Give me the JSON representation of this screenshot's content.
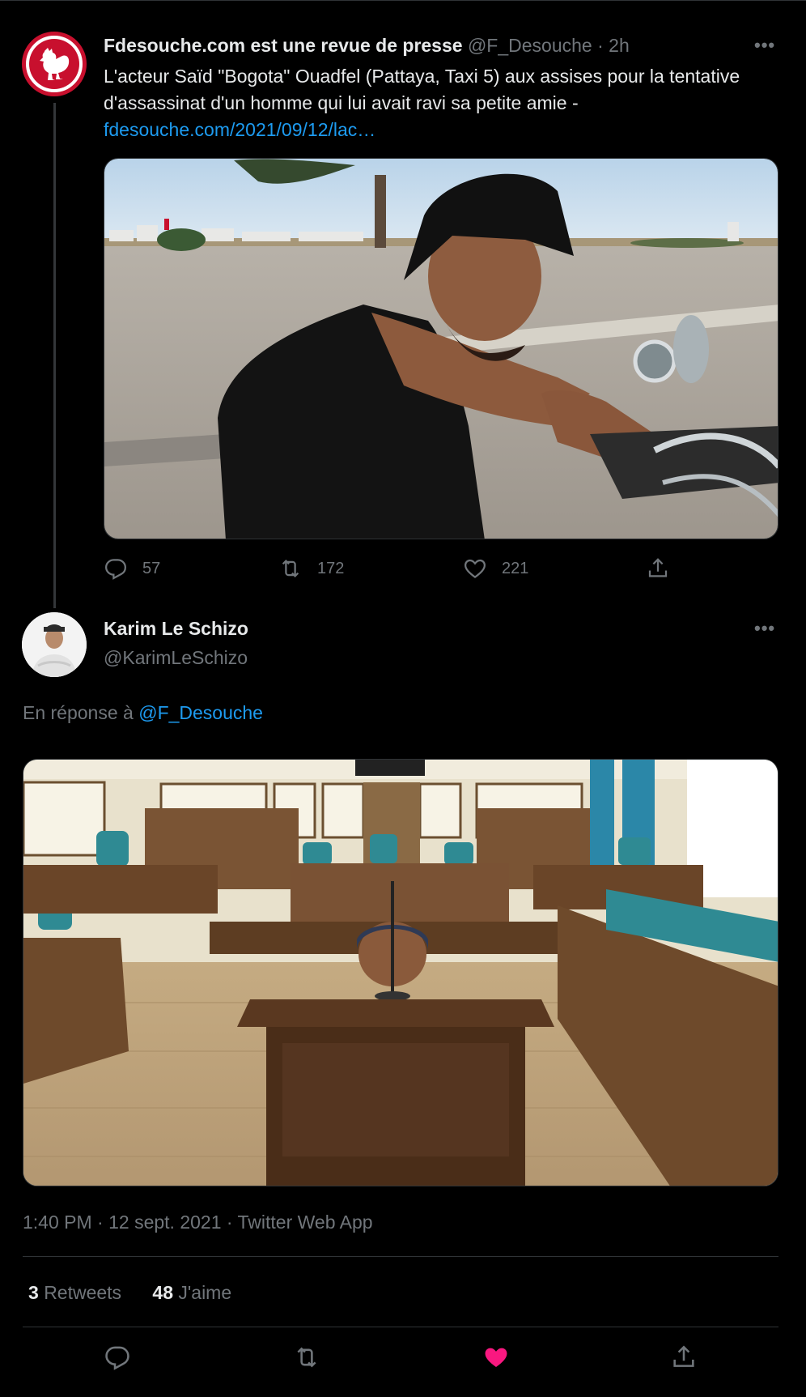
{
  "tweet1": {
    "author_name": "Fdesouche.com est une revue de presse",
    "handle": "@F_Desouche",
    "time": "· 2h",
    "more": "•••",
    "text": "L'acteur Saïd \"Bogota\" Ouadfel (Pattaya, Taxi 5) aux assises pour la tentative d'assassinat d'un homme qui lui avait ravi sa petite amie -",
    "link": "fdesouche.com/2021/09/12/lac…",
    "replies": "57",
    "retweets": "172",
    "likes": "221"
  },
  "tweet2": {
    "author_name": "Karim Le Schizo",
    "handle": "@KarimLeSchizo",
    "more": "•••",
    "reply_prefix": "En réponse à",
    "reply_to": "@F_Desouche",
    "timestamp": "1:40 PM · 12 sept. 2021 · Twitter Web App",
    "retweet_count": "3",
    "retweet_label": "Retweets",
    "like_count": "48",
    "like_label": "J'aime"
  },
  "colors": {
    "background": "#000000",
    "text": "#e7e9ea",
    "muted": "#71767b",
    "link": "#1d9bf0",
    "liked": "#f91880"
  },
  "icons": {
    "reply": "reply-icon",
    "retweet": "retweet-icon",
    "like": "heart-icon",
    "share": "share-icon"
  }
}
